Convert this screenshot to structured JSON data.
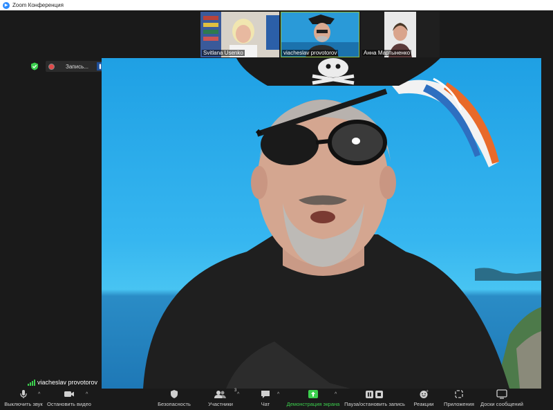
{
  "window": {
    "title": "Zoom Конференция"
  },
  "participants": [
    {
      "name": "Svitlana Usenko",
      "active": false
    },
    {
      "name": "viacheslav provotorov",
      "active": true
    },
    {
      "name": "Анна Мартыненко",
      "active": false
    }
  ],
  "recording": {
    "label": "Запись..."
  },
  "main_video": {
    "speaker": "viacheslav provotorov"
  },
  "toolbar": {
    "mute": "Выключить звук",
    "stop_video": "Остановить видео",
    "security": "Безопасность",
    "participants": "Участники",
    "participants_count": "3",
    "chat": "Чат",
    "share_screen": "Демонстрация экрана",
    "pause_stop_recording": "Пауза/остановить запись",
    "reactions": "Реакции",
    "apps": "Приложения",
    "whiteboards": "Доски сообщений"
  },
  "colors": {
    "accent_green": "#3ccf4e",
    "recording_red": "#e04a4a",
    "zoom_blue": "#2d8cff",
    "active_border": "#8fbf3f"
  }
}
